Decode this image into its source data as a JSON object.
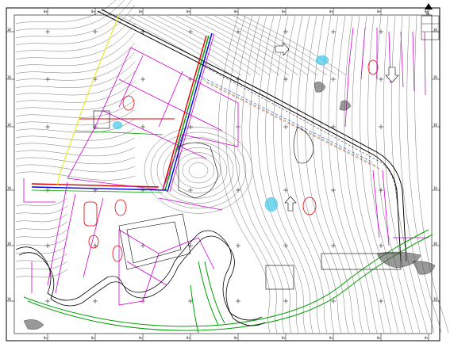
{
  "drawing": {
    "frame_top_ticks": [
      "0+",
      "0+",
      "0+",
      "0+",
      "0+",
      "0+",
      "0+",
      "0+",
      "0+"
    ],
    "frame_bottom_ticks": [
      "0+",
      "0+",
      "0+",
      "0+",
      "0+",
      "0+",
      "0+",
      "0+",
      "0+"
    ],
    "frame_left_ticks": [
      "10",
      "10",
      "10",
      "10",
      "10",
      "10"
    ],
    "frame_right_ticks": [
      "10",
      "10",
      "10",
      "10",
      "10",
      "10"
    ],
    "north_arrow_label": "N",
    "colors": {
      "frame": "#000000",
      "contour": "#333333",
      "magenta": "#d000d0",
      "red": "#e00000",
      "green": "#00a000",
      "blue": "#0000e0",
      "yellow": "#e8e800",
      "cyan": "#40c8e8"
    }
  }
}
